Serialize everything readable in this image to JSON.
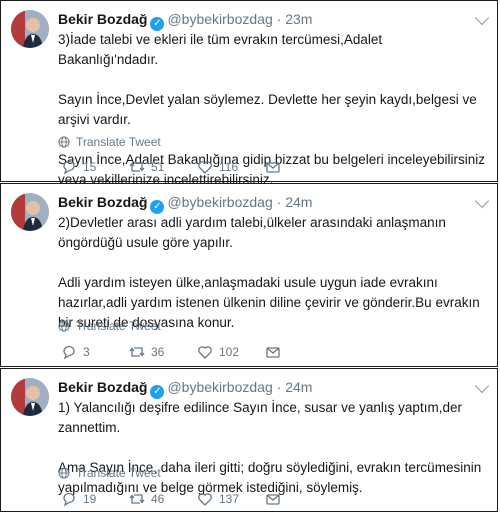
{
  "tweets": [
    {
      "name": "Bekir Bozdağ",
      "handle": "@bybekirbozdag",
      "dot": "·",
      "time": "23m",
      "paragraphs": [
        "3)İade talebi ve ekleri ile tüm evrakın tercümesi,Adalet Bakanlığı'ndadır.",
        "Sayın İnce,Devlet yalan söylemez. Devlette her şeyin kaydı,belgesi ve arşivi vardır.",
        "Sayın İnce,Adalet Bakanlığına gidip bizzat bu belgeleri inceleyebilirsiniz veya vekillerinize incelettirebilirsiniz."
      ],
      "translate": "Translate Tweet",
      "replies": "15",
      "retweets": "51",
      "likes": "116"
    },
    {
      "name": "Bekir Bozdağ",
      "handle": "@bybekirbozdag",
      "dot": "·",
      "time": "24m",
      "paragraphs": [
        "2)Devletler arası adli yardım talebi,ülkeler arasındaki anlaşmanın öngördüğü usule göre yapılır.",
        "Adli yardım isteyen ülke,anlaşmadaki usule uygun iade evrakını hazırlar,adli yardım istenen ülkenin diline çevirir ve gönderir.Bu evrakın bir sureti de dosyasına konur."
      ],
      "translate": "Translate Tweet",
      "replies": "3",
      "retweets": "36",
      "likes": "102"
    },
    {
      "name": "Bekir Bozdağ",
      "handle": "@bybekirbozdag",
      "dot": "·",
      "time": "24m",
      "paragraphs": [
        "1) Yalancılığı deşifre edilince Sayın İnce, susar ve yanlış yaptım,der zannettim.",
        "Ama Sayın İnce, daha ileri gitti; doğru söylediğini, evrakın tercümesinin yapılmadığını ve belge görmek istediğini, söylemiş."
      ],
      "translate": "Translate Tweet",
      "replies": "19",
      "retweets": "46",
      "likes": "137"
    }
  ],
  "icons": {
    "verified": "verified-badge-icon",
    "chevron": "chevron-down-icon",
    "globe": "globe-icon",
    "reply": "reply-icon",
    "retweet": "retweet-icon",
    "like": "heart-icon",
    "message": "direct-message-icon"
  },
  "colors": {
    "accent": "#1da1f2",
    "text": "#14171a",
    "muted": "#657786"
  }
}
